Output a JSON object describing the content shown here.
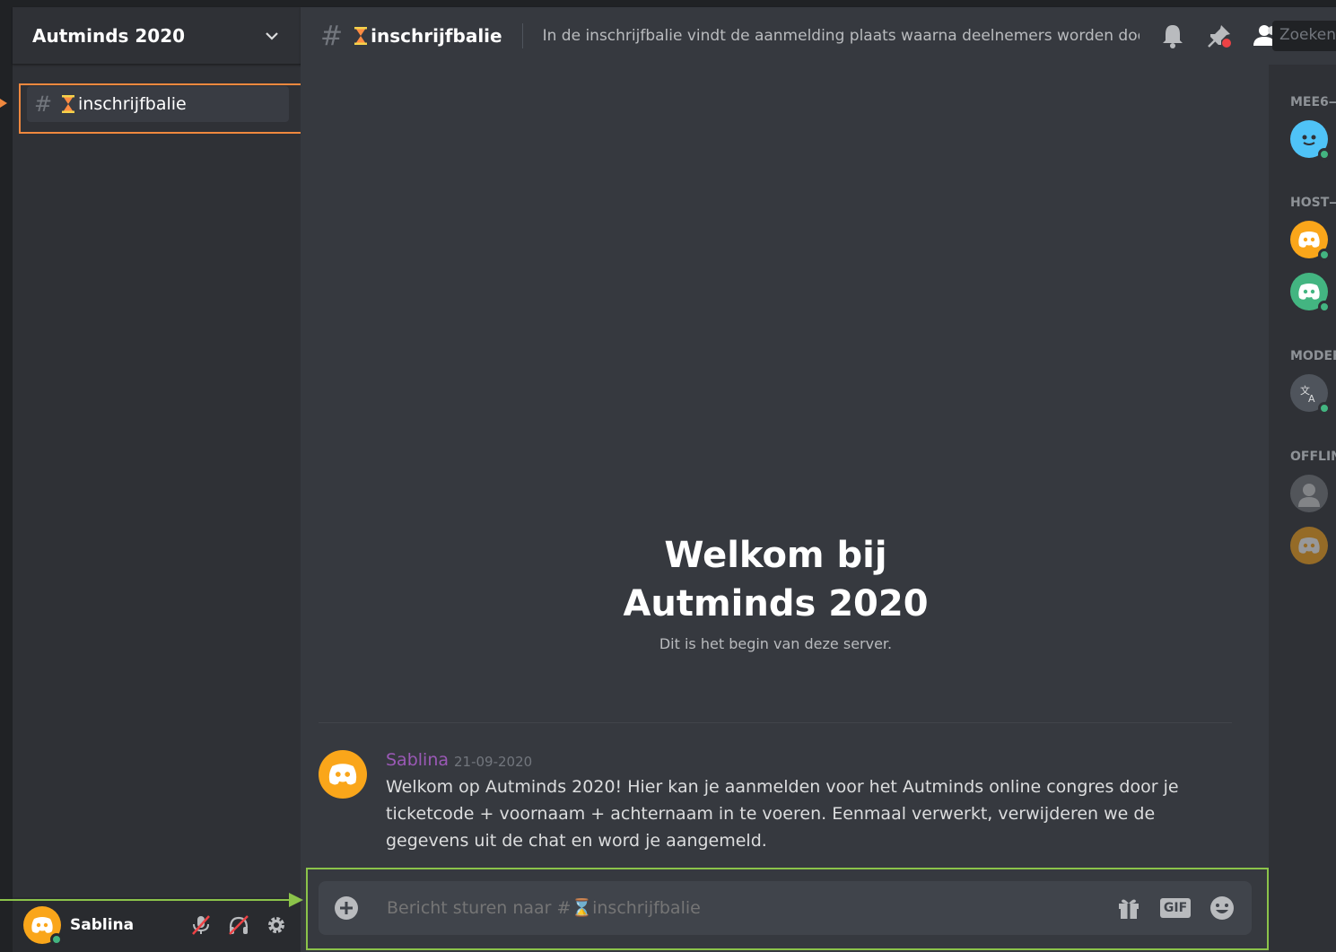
{
  "server": {
    "name": "Autminds 2020"
  },
  "sidebar": {
    "channels": [
      {
        "label": "inschrijfbalie"
      }
    ]
  },
  "user": {
    "name": "Sablina"
  },
  "topbar": {
    "channel": "inschrijfbalie",
    "topic": "In de inschrijfbalie vindt de aanmelding plaats waarna deelnemers worden doorver...",
    "search_label": "Zoeken"
  },
  "chat": {
    "welcome_title_line1": "Welkom bij",
    "welcome_title_line2": "Autminds 2020",
    "welcome_subtitle": "Dit is het begin van deze server.",
    "message": {
      "author": "Sablina",
      "timestamp": "21-09-2020",
      "text": "Welkom op Autminds 2020! Hier kan je aanmelden voor het Autminds online congres door je ticketcode + voornaam + achternaam in te voeren. Eenmaal verwerkt, verwijderen we de gegevens uit de chat en word je aangemeld."
    },
    "composer": {
      "placeholder": "Bericht sturen naar #⌛inschrijfbalie",
      "gif_label": "GIF"
    }
  },
  "members": {
    "groups": [
      "MEE6—",
      "HOST—",
      "MODER",
      "OFFLIN"
    ]
  },
  "colors": {
    "accent_orange": "#f0883e",
    "accent_green": "#8bc34a",
    "author_purple": "#9b59b6",
    "online": "#43b581"
  }
}
